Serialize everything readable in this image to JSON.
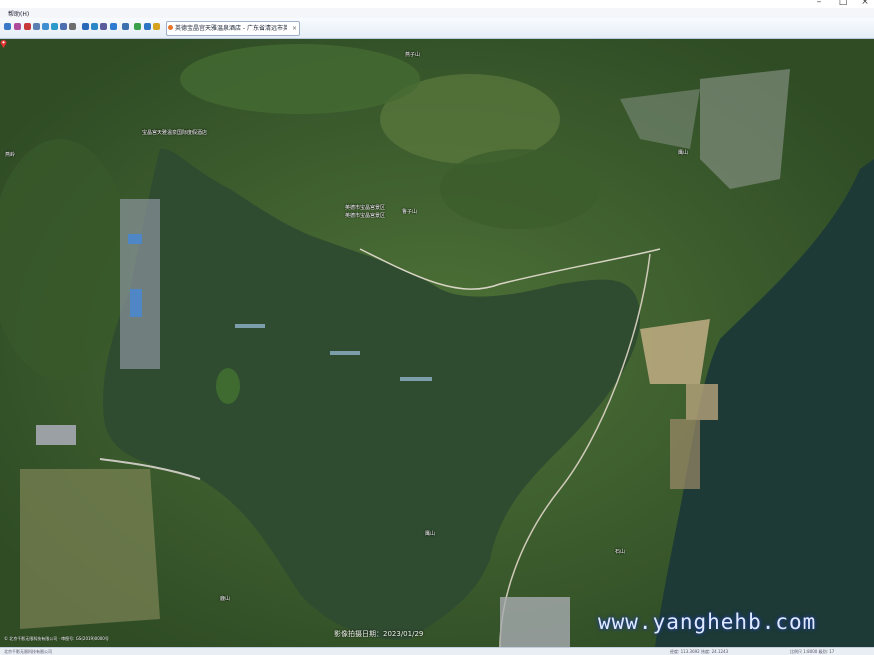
{
  "window": {
    "minimize": "–",
    "maximize": "□",
    "close": "×"
  },
  "menu": {
    "item": "帮助(H)"
  },
  "toolbar": {
    "tab_label": "英德宝晶宫天雅温泉酒店 - 广东省清远市英德市",
    "tab_close": "×"
  },
  "map": {
    "place_labels": [
      "宝晶宫天雅温泉国际度假酒店",
      "英德市宝晶宫景区",
      "英德市宝晶宫景区",
      "燕子山",
      "鲁子山",
      "鹰山",
      "燕岭",
      "鹰山",
      "石山",
      "鹿山"
    ],
    "capture_date": "影像拍摄日期：2023/01/29",
    "copyright": "© 北京千影无限科技有限公司 · 审图号: GS(2019)0000号",
    "watermark": "www.yanghehb.com"
  },
  "status": {
    "left": "北京千影无限科技有限公司",
    "coords": "经度: 113.3692  纬度: 24.1243",
    "right": "比例尺 1:8000   级别: 17"
  },
  "colors": {
    "water": "#2e4a33",
    "river": "#1f3d38",
    "forest": "#3d5f2e",
    "toolbar": "#e6edf6",
    "watermark": "#dfeaff"
  }
}
